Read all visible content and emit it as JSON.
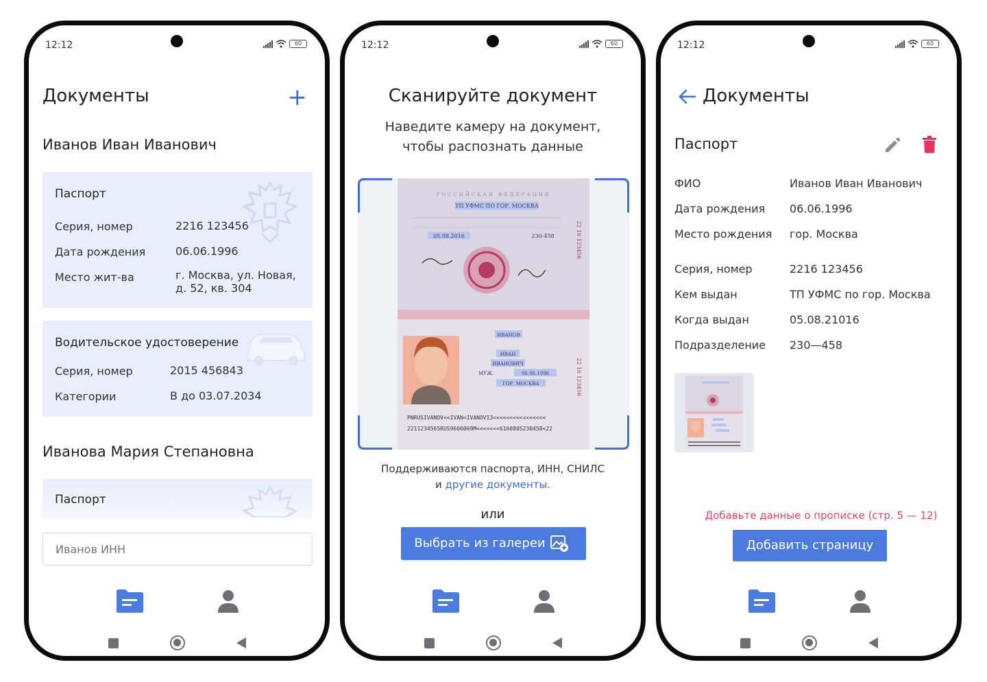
{
  "status": {
    "time": "12:12",
    "battery": "60"
  },
  "screen1": {
    "heading": "Документы",
    "plus": "+",
    "person1": "Иванов Иван Иванович",
    "passport": {
      "title": "Паспорт",
      "rows": [
        {
          "key": "Серия, номер",
          "value": "2216 123456"
        },
        {
          "key": "Дата рождения",
          "value": "06.06.1996"
        },
        {
          "key": "Место жит-ва",
          "value": "г. Москва, ул. Новая,",
          "value2": "д. 52, кв. 304"
        }
      ]
    },
    "license": {
      "title": "Водительское удостоверение",
      "rows": [
        {
          "key": "Серия, номер",
          "value": "2015 456843"
        },
        {
          "key": "Категории",
          "value": "B до 03.07.2034"
        }
      ]
    },
    "person2": "Иванова Мария Степановна",
    "passport2_title": "Паспорт",
    "input_placeholder": "Иванов ИНН"
  },
  "screen2": {
    "title": "Сканируйте документ",
    "subtitle_line1": "Наведите камеру на документ,",
    "subtitle_line2": "чтобы распознать данные",
    "support_line1": "Поддерживаются паспорта, ИНН, СНИЛС",
    "support_prefix": "и ",
    "support_link": "другие документы.",
    "or": "или",
    "gallery_button": "Выбрать из галереи",
    "passport_scan": {
      "country": "РОССИЙСКАЯ ФЕДЕРАЦИЯ",
      "issued_by": "ТП УФМС ПО ГОР. МОСКВА",
      "issue_date": "05.08.2016",
      "code": "230-458",
      "surname": "ИВАНОВ",
      "name": "ИВАН",
      "patronymic": "ИВАНОВИЧ",
      "sex": "МУЖ.",
      "birth_date": "06.06.1996",
      "birth_place": "ГОР. МОСКВА",
      "series_number": "22 16 123456",
      "mrz1": "PNRUSIVANOV<<IVAN<IVANOVI3<<<<<<<<<<<<<<<<",
      "mrz2": "2211234565RUS9606069M<<<<<<<6160805230458<22"
    }
  },
  "screen3": {
    "heading": "Документы",
    "doc_title": "Паспорт",
    "rows_a": [
      {
        "key": "ФИО",
        "value": "Иванов Иван Иванович"
      },
      {
        "key": "Дата рождения",
        "value": "06.06.1996"
      },
      {
        "key": "Место рождения",
        "value": "гор. Москва"
      }
    ],
    "rows_b": [
      {
        "key": "Серия, номер",
        "value": "2216 123456"
      },
      {
        "key": "Кем выдан",
        "value": "ТП УФМС по гор. Москва"
      },
      {
        "key": "Когда выдан",
        "value": "05.08.21016"
      },
      {
        "key": "Подразделение",
        "value": "230—458"
      }
    ],
    "warning": "Добавьте данные о прописке (стр. 5 — 12)",
    "add_button": "Добавить страницу"
  },
  "colors": {
    "accent": "#4c7be0",
    "card_bg": "#e8eefb",
    "warning": "#e0476f",
    "delete": "#e8325f",
    "icon_gray": "#6d6f75"
  },
  "icons": [
    "plus-icon",
    "folder-docs-icon",
    "user-icon",
    "camera-frame-corners",
    "gallery-add-icon",
    "back-arrow-icon",
    "pencil-icon",
    "trash-icon",
    "square-nav-icon",
    "home-nav-icon",
    "back-nav-icon"
  ]
}
